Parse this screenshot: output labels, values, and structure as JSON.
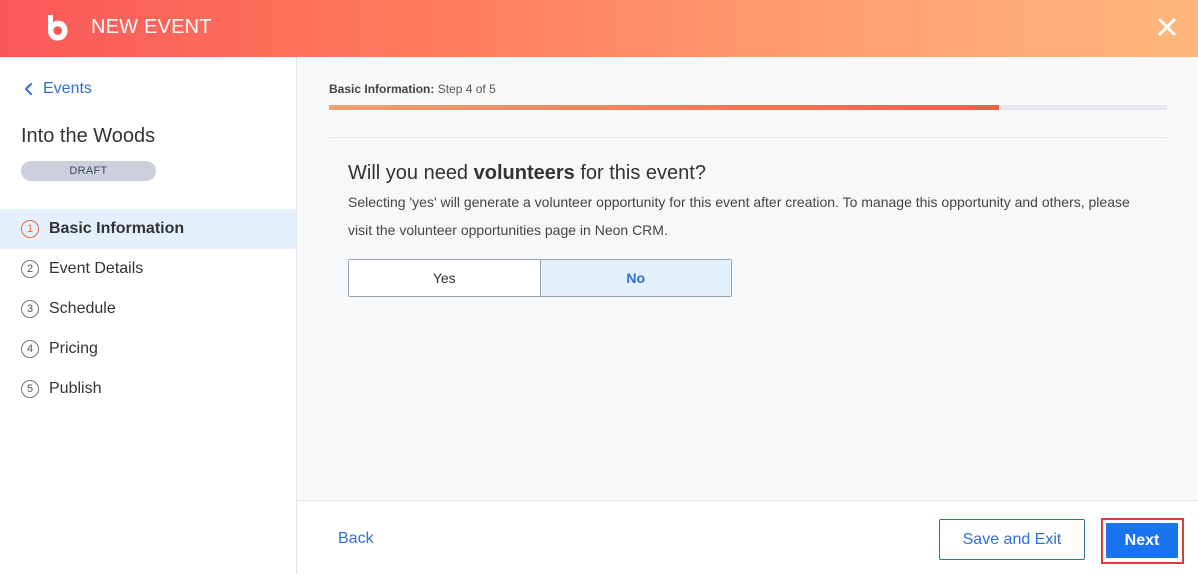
{
  "header": {
    "title": "NEW EVENT",
    "logo_icon": "brand-logo-icon",
    "close_icon": "close-icon"
  },
  "sidebar": {
    "back_label": "Events",
    "event_name": "Into the Woods",
    "status": "DRAFT",
    "steps": [
      {
        "num": "1",
        "label": "Basic Information",
        "active": true
      },
      {
        "num": "2",
        "label": "Event Details",
        "active": false
      },
      {
        "num": "3",
        "label": "Schedule",
        "active": false
      },
      {
        "num": "4",
        "label": "Pricing",
        "active": false
      },
      {
        "num": "5",
        "label": "Publish",
        "active": false
      }
    ]
  },
  "main": {
    "progress": {
      "section": "Basic Information:",
      "step_text": "Step 4 of 5",
      "fraction": 0.8
    },
    "question_prefix": "Will you need ",
    "question_bold": "volunteers",
    "question_suffix": " for this event?",
    "help_text": "Selecting 'yes' will generate a volunteer opportunity for this event after creation. To manage this opportunity and others, please visit the volunteer opportunities page in Neon CRM.",
    "options": [
      {
        "label": "Yes",
        "selected": false
      },
      {
        "label": "No",
        "selected": true
      }
    ]
  },
  "footer": {
    "back_label": "Back",
    "save_label": "Save and Exit",
    "next_label": "Next"
  },
  "colors": {
    "accent_blue": "#1a73f0",
    "link_blue": "#2f6fd6",
    "header_gradient_start": "#f95858",
    "header_gradient_end": "#ffb67a",
    "active_step": "#f06a3a",
    "highlight_outline": "#d63d3d"
  }
}
